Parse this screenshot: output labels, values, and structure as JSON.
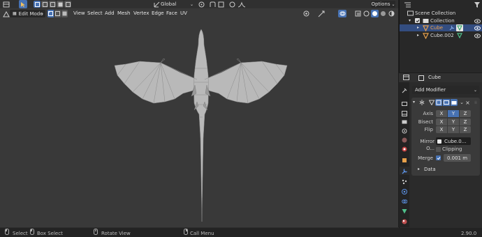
{
  "colors": {
    "accent": "#4772b3",
    "header": "#303030",
    "viewport": "#393939",
    "panel": "#2b2b2b",
    "object_orange": "#e8a04a",
    "data_green": "#4fbf8a"
  },
  "top_bar": {
    "transform_orientation": "Global",
    "options_label": "Options"
  },
  "viewport_header": {
    "mode": "Edit Mode",
    "menus": [
      "View",
      "Select",
      "Add",
      "Mesh",
      "Vertex",
      "Edge",
      "Face",
      "UV"
    ]
  },
  "outliner": {
    "scene_collection": "Scene Collection",
    "collection": "Collection",
    "items": [
      "Cube",
      "Cube.002"
    ]
  },
  "properties": {
    "object_name": "Cube",
    "add_modifier": "Add Modifier",
    "axis_label": "Axis",
    "bisect_label": "Bisect",
    "flip_label": "Flip",
    "xyz": [
      "X",
      "Y",
      "Z"
    ],
    "mirror_object_label": "Mirror O...",
    "mirror_object_value": "Cube.0...",
    "clipping_label": "Clipping",
    "merge_label": "Merge",
    "merge_value": "0.001 m",
    "data_label": "Data"
  },
  "status_bar": {
    "select": "Select",
    "box_select": "Box Select",
    "rotate_view": "Rotate View",
    "call_menu": "Call Menu",
    "version": "2.90.0"
  }
}
